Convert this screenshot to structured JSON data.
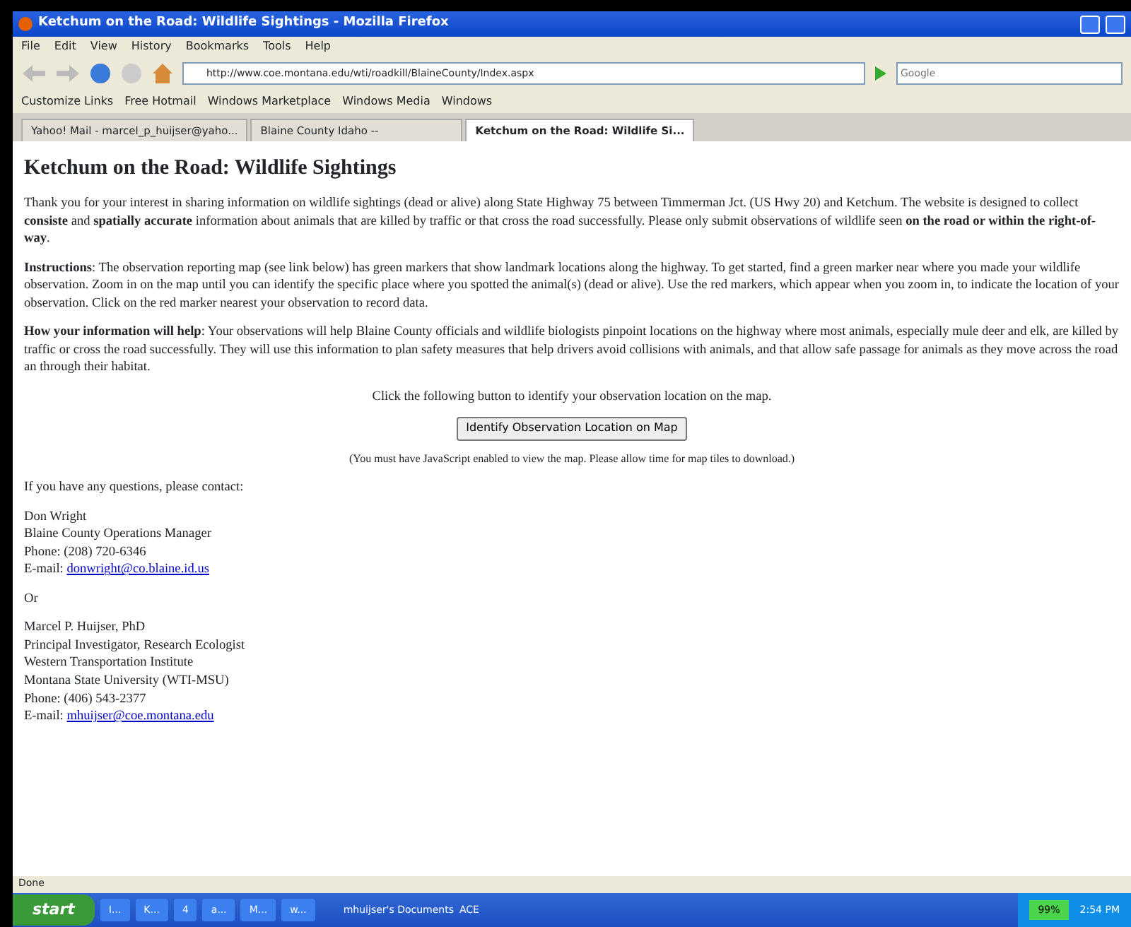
{
  "window": {
    "title": "Ketchum on the Road: Wildlife Sightings - Mozilla Firefox"
  },
  "menu": [
    "File",
    "Edit",
    "View",
    "History",
    "Bookmarks",
    "Tools",
    "Help"
  ],
  "address_bar": {
    "value": "http://www.coe.montana.edu/wti/roadkill/BlaineCounty/Index.aspx"
  },
  "search": {
    "placeholder": "Google"
  },
  "bookmarks": [
    "Customize Links",
    "Free Hotmail",
    "Windows Marketplace",
    "Windows Media",
    "Windows"
  ],
  "tabs": [
    {
      "label": "Yahoo! Mail - marcel_p_huijser@yaho...",
      "selected": false
    },
    {
      "label": "Blaine County Idaho --",
      "selected": false
    },
    {
      "label": "Ketchum on the Road: Wildlife Si...",
      "selected": true
    }
  ],
  "page": {
    "heading": "Ketchum on the Road: Wildlife Sightings",
    "paragraphs": [
      "Thank you for your interest in sharing information on wildlife sightings (dead or alive) along State Highway 75 between Timmerman Jct. (US Hwy 20) and Ketchum. The website is designed to collect **consiste** and **spatially accurate** information about animals that are killed by traffic or that cross the road successfully. Please only submit observations of wildlife seen **on the road or within the right-of-way**.",
      "**Instructions**: The observation reporting map (see link below) has green markers that show landmark locations along the highway. To get started, find a green marker near where you made your wildlife observation. Zoom in on the map until you can identify the specific place where you spotted the animal(s) (dead or alive). Use the red markers, which appear when you zoom in, to indicate the location of your observation. Click on the red marker nearest your observation to record data.",
      "**How your information will help**: Your observations will help Blaine County officials and wildlife biologists pinpoint locations on the highway where most animals, especially mule deer and elk, are killed by traffic or cross the road successfully. They will use this information to plan safety measures that help drivers avoid collisions with animals, and that allow safe passage for animals as they move across the road an through their habitat."
    ],
    "prompt": "Click the following button to identify your observation location on the map.",
    "button": "Identify Observation Location on Map",
    "note": "(You must have JavaScript enabled to view the map. Please allow time for map tiles to download.)",
    "contact_intro": "If you have any questions, please contact:",
    "contacts": [
      {
        "lines": [
          "Don Wright",
          "Blaine County Operations Manager",
          "Phone: (208) 720-6346"
        ],
        "email_label": "E-mail:",
        "email": "donwright@co.blaine.id.us"
      },
      {
        "lines": [
          "Marcel P. Huijser, PhD",
          "Principal Investigator, Research Ecologist",
          "Western Transportation Institute",
          "Montana State University (WTI-MSU)",
          "Phone: (406) 543-2377"
        ],
        "email_label": "E-mail:",
        "email": "mhuijser@coe.montana.edu"
      }
    ],
    "separator": "Or"
  },
  "status_bar": "Done",
  "taskbar": {
    "start": "start",
    "items": [
      "I...",
      "K...",
      "4",
      "a...",
      "M...",
      "w..."
    ],
    "folder": "mhuijser's Documents",
    "folder2": "ACE",
    "battery": "99%",
    "clock": "2:54 PM"
  }
}
